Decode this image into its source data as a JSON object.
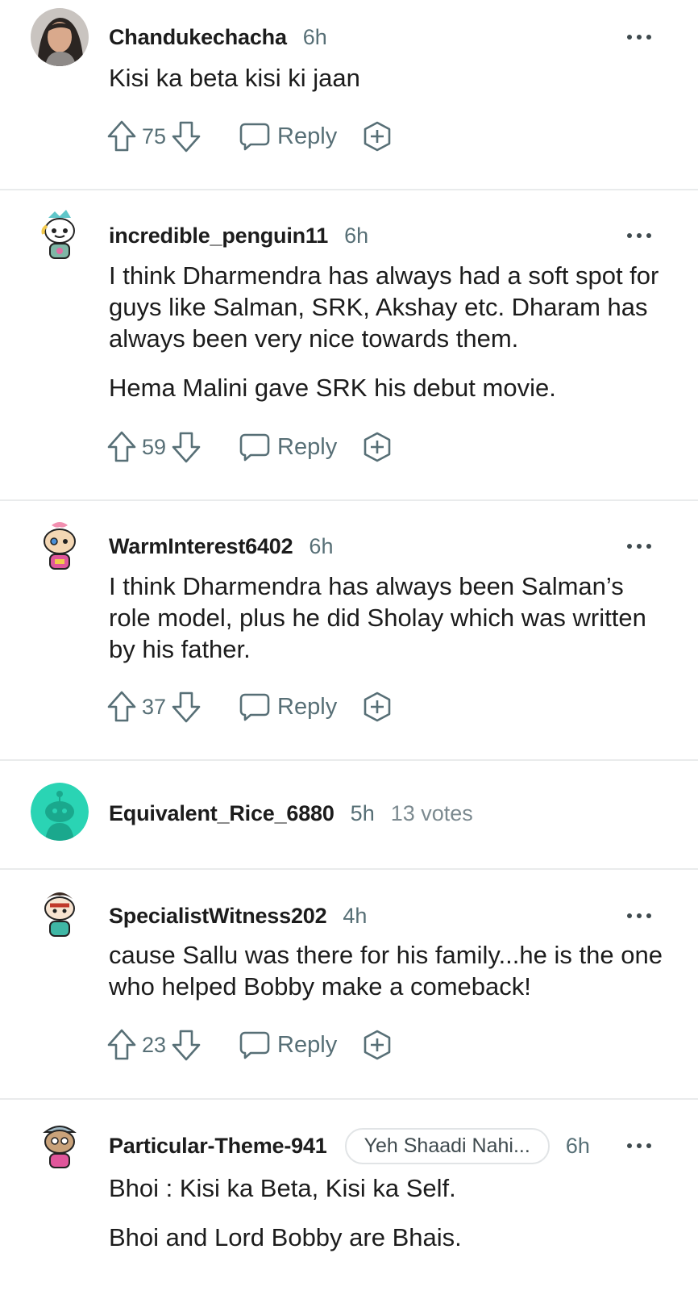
{
  "ui": {
    "reply_label": "Reply"
  },
  "comments": [
    {
      "username": "Chandukechacha",
      "time": "6h",
      "paragraphs": [
        "Kisi ka beta kisi ki jaan"
      ],
      "score": "75",
      "avatar": "profile-photo"
    },
    {
      "username": "incredible_penguin11",
      "time": "6h",
      "paragraphs": [
        "I think Dharmendra has always had a soft spot for guys like Salman, SRK, Akshay etc. Dharam has always been very nice towards them.",
        "Hema Malini gave SRK his debut movie."
      ],
      "score": "59",
      "avatar": "snoo-avatar"
    },
    {
      "username": "WarmInterest6402",
      "time": "6h",
      "paragraphs": [
        "I think Dharmendra has always been Salman’s role model, plus he did Sholay which was written by his father."
      ],
      "score": "37",
      "avatar": "snoo-avatar"
    },
    {
      "username": "Equivalent_Rice_6880",
      "time": "5h",
      "votes": "13 votes",
      "collapsed": true,
      "avatar": "default-snoo-avatar"
    },
    {
      "username": "SpecialistWitness202",
      "time": "4h",
      "paragraphs": [
        "cause Sallu was there for his family...he is the one who helped Bobby make a comeback!"
      ],
      "score": "23",
      "avatar": "snoo-avatar"
    },
    {
      "username": "Particular-Theme-941",
      "flair": "Yeh Shaadi Nahi...",
      "time": "6h",
      "paragraphs": [
        "Bhoi : Kisi ka Beta, Kisi ka Self.",
        "Bhoi and Lord Bobby are Bhais."
      ],
      "avatar": "snoo-avatar"
    }
  ],
  "colors": {
    "text": "#1c1c1c",
    "meta": "#576f76",
    "divider": "#e9ebec",
    "default_avatar_bg": "#2ad4b4"
  }
}
